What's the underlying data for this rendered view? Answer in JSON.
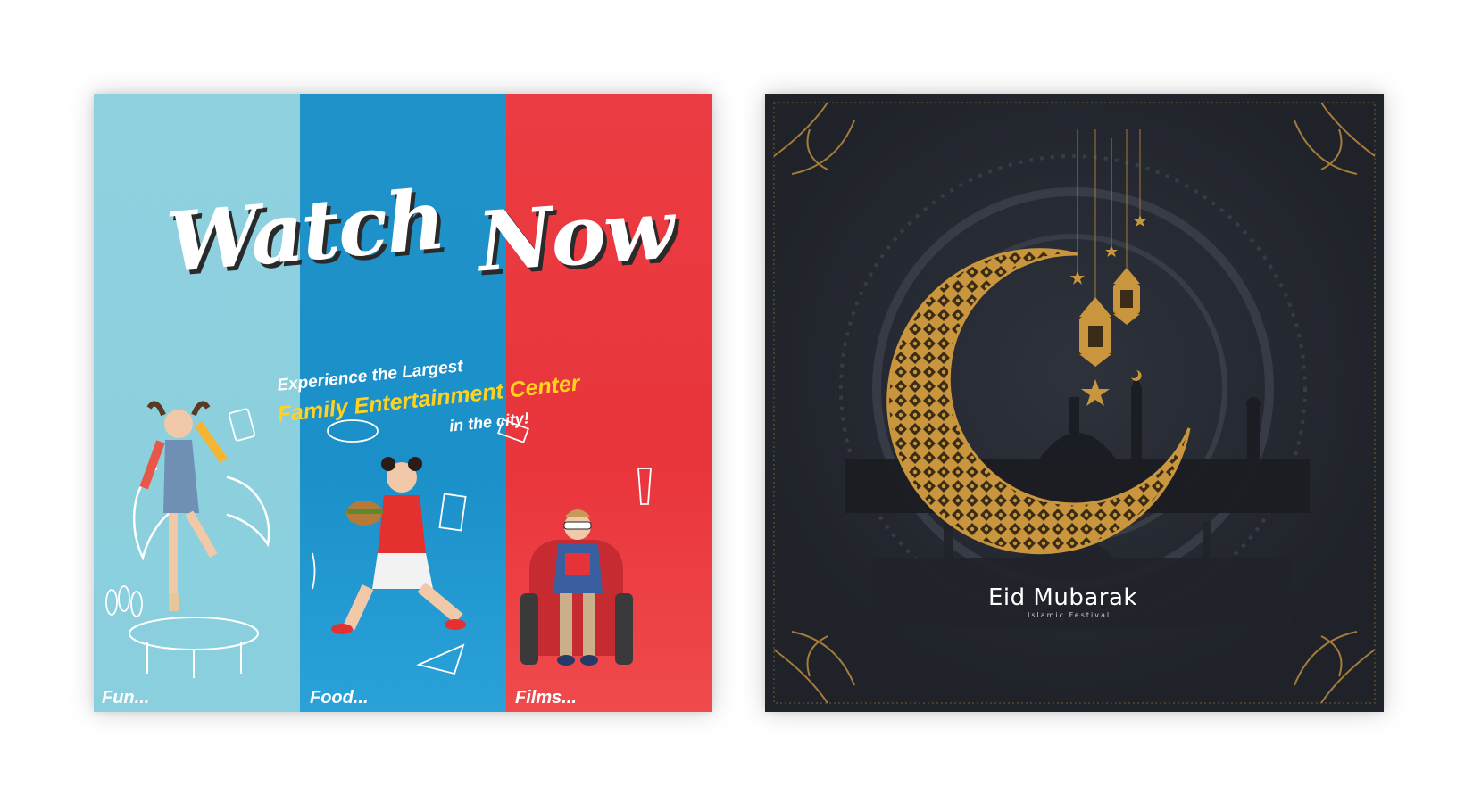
{
  "left_poster": {
    "title_word_1": "Watch",
    "title_word_2": "Now",
    "tagline_line_1": "Experience the Largest",
    "tagline_line_2": "Family Entertainment Center",
    "tagline_line_3": "in the city!",
    "captions": [
      "Fun...",
      "Food...",
      "Films..."
    ],
    "colors": {
      "fun": "#8fd1df",
      "food": "#1f93c9",
      "films": "#ea3c42",
      "highlight": "#ffd21f"
    }
  },
  "right_poster": {
    "title": "Eid Mubarak",
    "subtitle": "Islamic Festival",
    "colors": {
      "background": "#24272f",
      "gold": "#c9963e"
    }
  }
}
